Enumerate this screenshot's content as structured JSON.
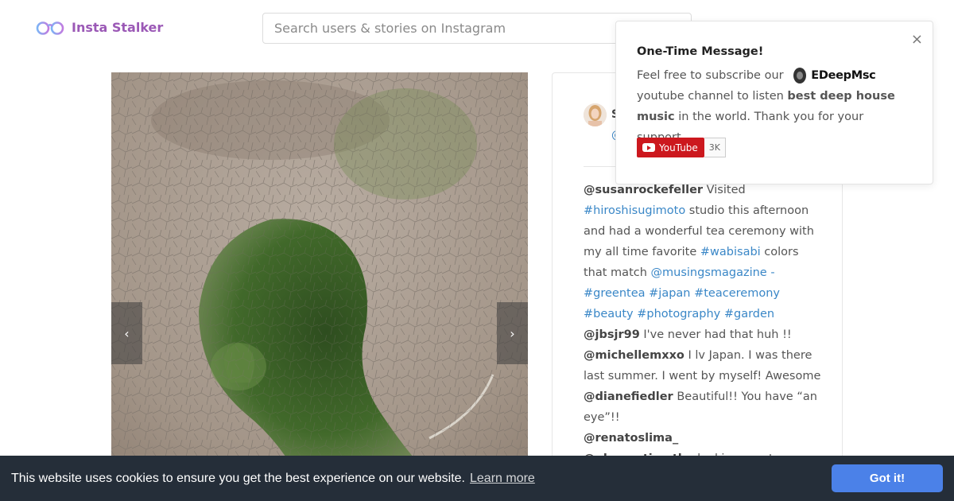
{
  "header": {
    "logo_icon": "glasses-icon",
    "logo_text": "Insta Stalker",
    "search_placeholder": "Search users & stories on Instagram"
  },
  "carousel": {
    "prev_icon": "chevron-left-icon",
    "prev_glyph": "‹",
    "next_icon": "chevron-right-icon",
    "next_glyph": "›"
  },
  "post": {
    "author_initial": "S",
    "author_handle_prefix": "@",
    "comments": [
      {
        "user": "@susanrockefeller",
        "parts": [
          {
            "t": " Visited ",
            "k": "text"
          },
          {
            "t": "#hiroshisugimoto",
            "k": "tag"
          },
          {
            "t": " studio this afternoon and had a wonderful tea ceremony with my all time favorite ",
            "k": "text"
          },
          {
            "t": "#wabisabi",
            "k": "tag"
          },
          {
            "t": " colors that match ",
            "k": "text"
          },
          {
            "t": "@musingsmagazine",
            "k": "tag"
          },
          {
            "t": " - ",
            "k": "tag"
          },
          {
            "t": "#greentea",
            "k": "tag"
          },
          {
            "t": " ",
            "k": "text"
          },
          {
            "t": "#japan",
            "k": "tag"
          },
          {
            "t": " ",
            "k": "text"
          },
          {
            "t": "#teaceremony",
            "k": "tag"
          },
          {
            "t": " ",
            "k": "text"
          },
          {
            "t": "#beauty",
            "k": "tag"
          },
          {
            "t": " ",
            "k": "text"
          },
          {
            "t": "#photography",
            "k": "tag"
          },
          {
            "t": " ",
            "k": "text"
          },
          {
            "t": "#garden",
            "k": "tag"
          }
        ]
      },
      {
        "user": "@jbsjr99",
        "parts": [
          {
            "t": " I've never had that huh !!",
            "k": "text"
          }
        ]
      },
      {
        "user": "@michellemxxo",
        "parts": [
          {
            "t": " I lv Japan. I was there last summer. I went by myself! Awesome",
            "k": "text"
          }
        ]
      },
      {
        "user": "@dianefiedler",
        "parts": [
          {
            "t": " Beautiful!! You have “an eye”!!",
            "k": "text"
          }
        ]
      },
      {
        "user": "@renatoslima_",
        "parts": [
          {
            "t": " ",
            "k": "text"
          }
        ]
      },
      {
        "user": "@gloverstimothy",
        "parts": [
          {
            "t": " looking great",
            "k": "text"
          }
        ]
      }
    ]
  },
  "popup": {
    "title": "One-Time Message!",
    "close_glyph": "×",
    "close_icon": "close-icon",
    "body_prefix": "Feel free to subscribe our",
    "channel_name": "EDeepMsc",
    "body_mid": "youtube channel to listen",
    "body_bold": "best deep house music",
    "body_suffix": "in the world. Thank you for your support.",
    "yt_label": "YouTube",
    "yt_icon": "youtube-play-icon",
    "yt_count": "3K"
  },
  "cookie": {
    "message": "This website uses cookies to ensure you get the best experience on our website.",
    "link": "Learn more",
    "button": "Got it!"
  },
  "colors": {
    "accent": "#9b59b6",
    "link": "#3a87c7",
    "cookie_bg": "#252e39",
    "cookie_button": "#4b81e8",
    "youtube_red": "#cc181e"
  }
}
